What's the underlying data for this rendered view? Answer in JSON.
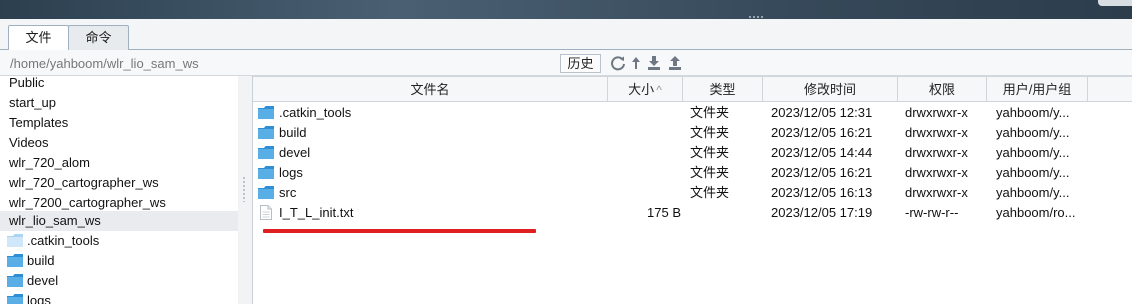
{
  "tabs": [
    {
      "label": "文件"
    },
    {
      "label": "命令"
    }
  ],
  "path": {
    "value": "/home/yahboom/wlr_lio_sam_ws"
  },
  "toolbar": {
    "history_label": "历史"
  },
  "sidebar": {
    "items": [
      {
        "label": "Public"
      },
      {
        "label": "start_up"
      },
      {
        "label": "Templates"
      },
      {
        "label": "Videos"
      },
      {
        "label": "wlr_720_alom"
      },
      {
        "label": "wlr_720_cartographer_ws"
      },
      {
        "label": "wlr_7200_cartographer_ws"
      },
      {
        "label": "wlr_lio_sam_ws"
      },
      {
        "label": ".catkin_tools"
      },
      {
        "label": "build"
      },
      {
        "label": "devel"
      },
      {
        "label": "logs"
      }
    ]
  },
  "table": {
    "columns": {
      "name": "文件名",
      "size": "大小",
      "type": "类型",
      "mtime": "修改时间",
      "perm": "权限",
      "owner": "用户/用户组"
    },
    "rows": [
      {
        "name": ".catkin_tools",
        "size": "",
        "type": "文件夹",
        "mtime": "2023/12/05 12:31",
        "perm": "drwxrwxr-x",
        "owner": "yahboom/y..."
      },
      {
        "name": "build",
        "size": "",
        "type": "文件夹",
        "mtime": "2023/12/05 16:21",
        "perm": "drwxrwxr-x",
        "owner": "yahboom/y..."
      },
      {
        "name": "devel",
        "size": "",
        "type": "文件夹",
        "mtime": "2023/12/05 14:44",
        "perm": "drwxrwxr-x",
        "owner": "yahboom/y..."
      },
      {
        "name": "logs",
        "size": "",
        "type": "文件夹",
        "mtime": "2023/12/05 16:21",
        "perm": "drwxrwxr-x",
        "owner": "yahboom/y..."
      },
      {
        "name": "src",
        "size": "",
        "type": "文件夹",
        "mtime": "2023/12/05 16:13",
        "perm": "drwxrwxr-x",
        "owner": "yahboom/y..."
      },
      {
        "name": "I_T_L_init.txt",
        "size": "175 B",
        "type": "",
        "mtime": "2023/12/05 17:19",
        "perm": "-rw-rw-r--",
        "owner": "yahboom/ro..."
      }
    ]
  },
  "colors": {
    "folder": "#5aaee6",
    "highlight_underline": "#e02020",
    "selected_row": "#e9ebee"
  },
  "icons": {
    "refresh": "refresh-icon",
    "upload": "upload-icon",
    "download": "download-icon",
    "parent_dir": "up-arrow-icon"
  }
}
